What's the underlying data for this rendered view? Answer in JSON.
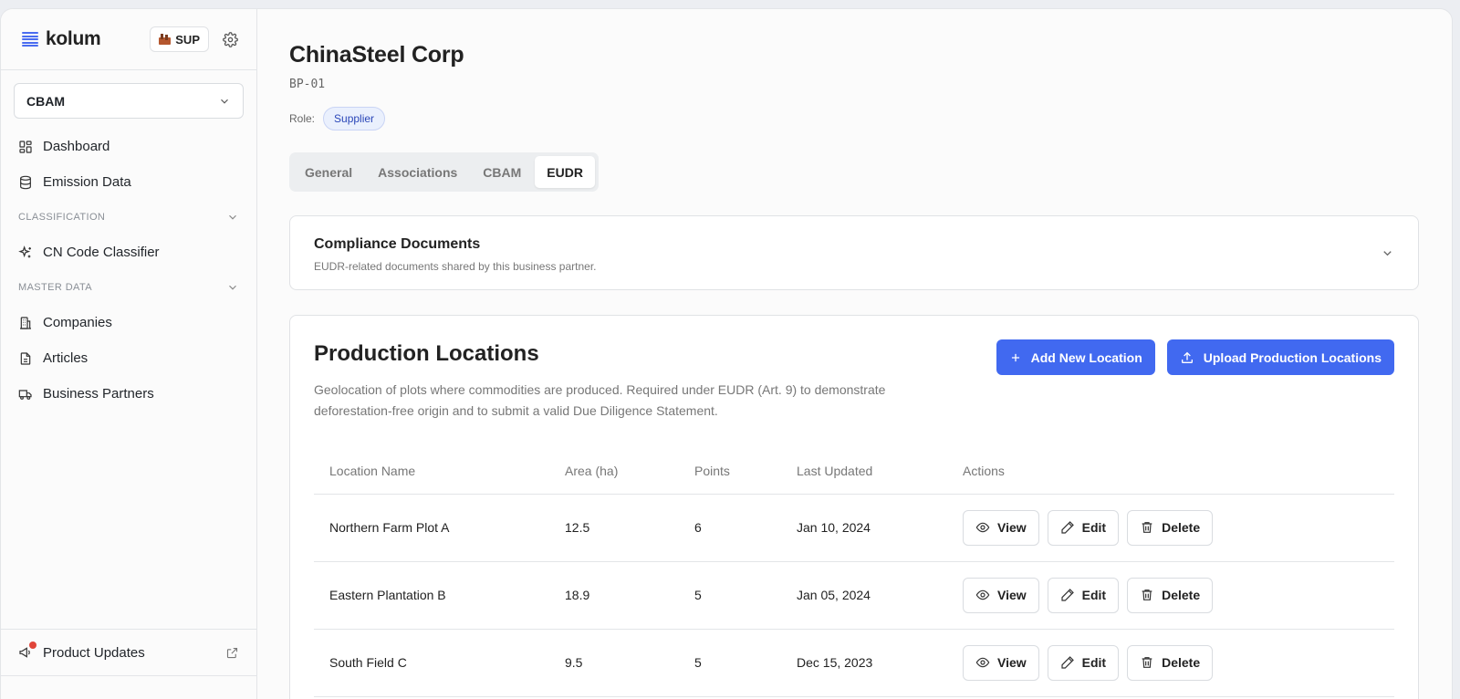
{
  "sidebar": {
    "logo": "kolum",
    "badge": "SUP",
    "selector": "CBAM",
    "items_top": [
      {
        "label": "Dashboard",
        "icon": "dashboard-icon"
      },
      {
        "label": "Emission Data",
        "icon": "database-icon"
      }
    ],
    "section_classification": "CLASSIFICATION",
    "items_classification": [
      {
        "label": "CN Code Classifier",
        "icon": "sparkles-icon"
      }
    ],
    "section_master": "MASTER DATA",
    "items_master": [
      {
        "label": "Companies",
        "icon": "building-icon"
      },
      {
        "label": "Articles",
        "icon": "file-icon"
      },
      {
        "label": "Business Partners",
        "icon": "truck-icon"
      }
    ],
    "product_updates": "Product Updates"
  },
  "main": {
    "title": "ChinaSteel Corp",
    "code": "BP-01",
    "role_label": "Role:",
    "role_value": "Supplier",
    "tabs": [
      {
        "label": "General",
        "active": false
      },
      {
        "label": "Associations",
        "active": false
      },
      {
        "label": "CBAM",
        "active": false
      },
      {
        "label": "EUDR",
        "active": true
      }
    ],
    "docs": {
      "title": "Compliance Documents",
      "subtitle": "EUDR-related documents shared by this business partner."
    },
    "locations": {
      "title": "Production Locations",
      "description": "Geolocation of plots where commodities are produced. Required under EUDR (Art. 9) to demonstrate deforestation-free origin and to submit a valid Due Diligence Statement.",
      "add_button": "Add New Location",
      "upload_button": "Upload Production Locations",
      "columns": [
        "Location Name",
        "Area (ha)",
        "Points",
        "Last Updated",
        "Actions"
      ],
      "rows": [
        {
          "name": "Northern Farm Plot A",
          "area": "12.5",
          "points": "6",
          "updated": "Jan 10, 2024"
        },
        {
          "name": "Eastern Plantation B",
          "area": "18.9",
          "points": "5",
          "updated": "Jan 05, 2024"
        },
        {
          "name": "South Field C",
          "area": "9.5",
          "points": "5",
          "updated": "Dec 15, 2023"
        }
      ],
      "row_actions": {
        "view": "View",
        "edit": "Edit",
        "delete": "Delete"
      }
    }
  },
  "colors": {
    "accent": "#4169f0",
    "pill_bg": "#eaf0fd",
    "pill_text": "#2a46b8",
    "notification": "#e0453a"
  }
}
